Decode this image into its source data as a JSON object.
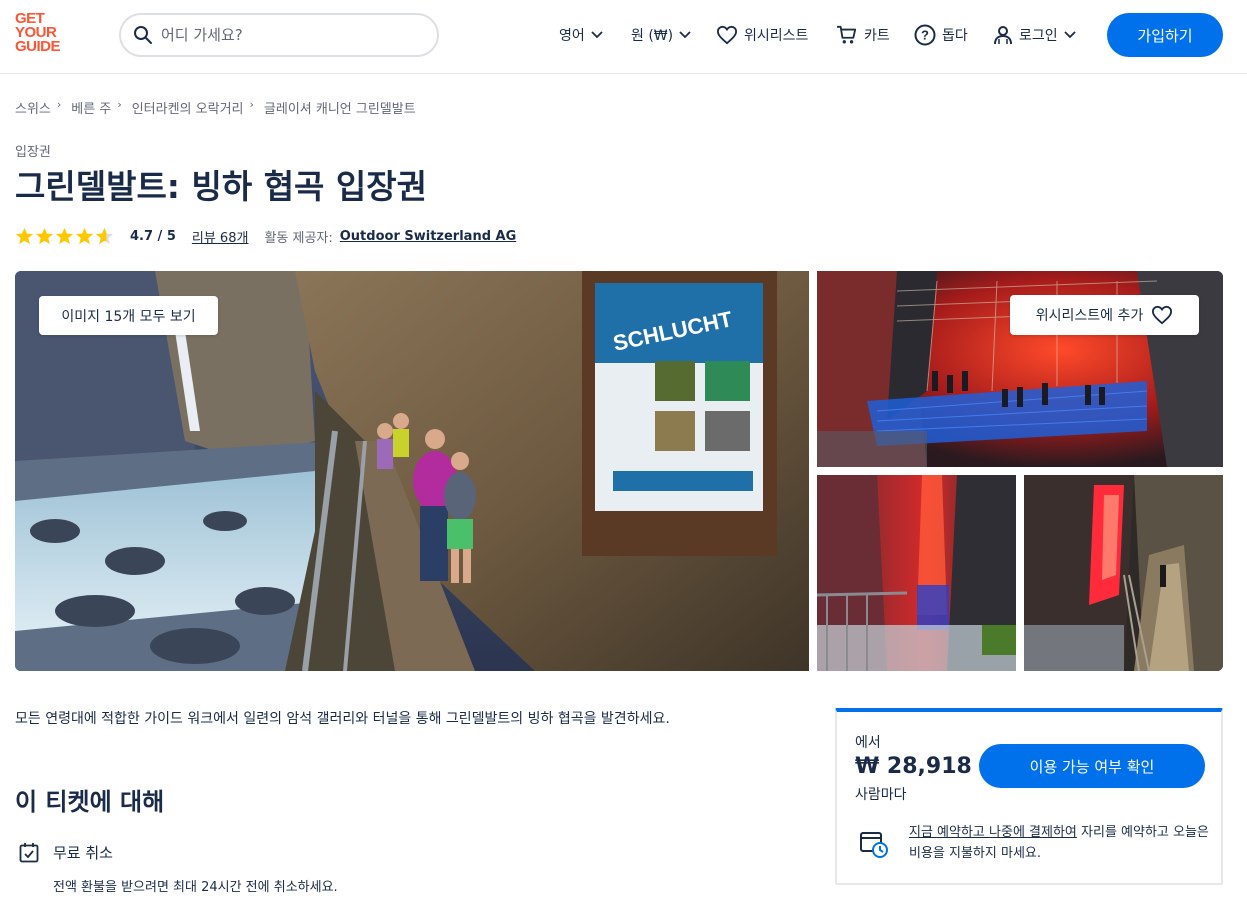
{
  "header": {
    "logo": [
      "GET",
      "YOUR",
      "GUIDE"
    ],
    "search_placeholder": "어디 가세요?",
    "language": "영어",
    "currency": "원 (₩)",
    "wishlist": "위시리스트",
    "cart": "카트",
    "help": "돕다",
    "login": "로그인",
    "signup": "가입하기"
  },
  "breadcrumb": [
    "스위스",
    "베른 주",
    "인터라켄의 오락거리",
    "글레이셔 캐니언 그린델발트"
  ],
  "product": {
    "category": "입장권",
    "title": "그린델발트: 빙하 협곡 입장권",
    "rating": 4.7,
    "rating_text": "4.7 / 5",
    "reviews": "리뷰 68개",
    "provider_label": "활동 제공자:",
    "provider": "Outdoor Switzerland AG"
  },
  "gallery": {
    "view_all": "이미지 15개 모두 보기",
    "wishlist_add": "위시리스트에 추가"
  },
  "description": "모든 연령대에 적합한 가이드 워크에서 일련의 암석 갤러리와 터널을 통해 그린델발트의 빙하 협곡을 발견하세요.",
  "about": {
    "heading": "이 티켓에 대해",
    "free_cancel": "무료 취소",
    "free_cancel_sub": "전액 환불을 받으려면 최대 24시간 전에 취소하세요."
  },
  "booking": {
    "from": "에서",
    "price": "₩ 28,918",
    "per": "사람마다",
    "check_button": "이용 가능 여부 확인",
    "reserve_link": "지금 예약하고 나중에 결제하여",
    "reserve_rest": " 자리를 예약하고 오늘은 비용을 지불하지 마세요."
  },
  "colors": {
    "brand": "#ff5533",
    "accent": "#0071eb",
    "text": "#1a2b49",
    "star": "#ffc800"
  }
}
